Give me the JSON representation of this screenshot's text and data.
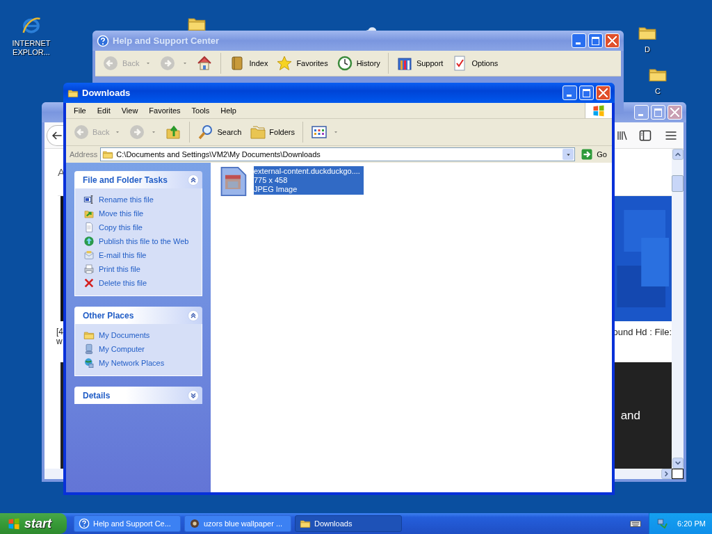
{
  "desktop_icons": [
    {
      "kind": "browser",
      "label": "INTERNET EXPLOR..."
    },
    {
      "kind": "folder-partial"
    },
    {
      "kind": "app-partial"
    },
    {
      "kind": "folder",
      "label": "D"
    },
    {
      "kind": "folder",
      "label": "C"
    }
  ],
  "browser_window": {
    "heading_fragment": "A",
    "caption_left": [
      "[4",
      "w"
    ],
    "caption_right": "ound Hd : File:",
    "banner_text": "and"
  },
  "help_window": {
    "title": "Help and Support Center",
    "toolbar": [
      {
        "kind": "back",
        "label": "Back",
        "disabled": true
      },
      {
        "kind": "forward",
        "disabled": true
      },
      {
        "kind": "home",
        "disabled": false
      },
      {
        "kind": "separator"
      },
      {
        "kind": "index",
        "label": "Index",
        "disabled": false
      },
      {
        "kind": "favorites",
        "label": "Favorites",
        "disabled": false
      },
      {
        "kind": "history",
        "label": "History",
        "disabled": false
      },
      {
        "kind": "separator"
      },
      {
        "kind": "support",
        "label": "Support",
        "disabled": false
      },
      {
        "kind": "options",
        "label": "Options",
        "disabled": false
      }
    ]
  },
  "downloads_window": {
    "title": "Downloads",
    "menu": [
      "File",
      "Edit",
      "View",
      "Favorites",
      "Tools",
      "Help"
    ],
    "toolbar": [
      {
        "kind": "back",
        "label": "Back",
        "disabled": true
      },
      {
        "kind": "forward",
        "disabled": true
      },
      {
        "kind": "up",
        "disabled": false
      },
      {
        "kind": "separator"
      },
      {
        "kind": "search",
        "label": "Search",
        "disabled": false
      },
      {
        "kind": "folders",
        "label": "Folders",
        "disabled": false
      },
      {
        "kind": "separator"
      },
      {
        "kind": "views",
        "disabled": false
      }
    ],
    "address": {
      "label": "Address",
      "value": "C:\\Documents and Settings\\VM2\\My Documents\\Downloads",
      "go": "Go"
    },
    "panels": [
      {
        "title": "File and Folder Tasks",
        "expanded": true,
        "items": [
          {
            "kind": "rename",
            "label": "Rename this file"
          },
          {
            "kind": "move",
            "label": "Move this file"
          },
          {
            "kind": "copy",
            "label": "Copy this file"
          },
          {
            "kind": "publish",
            "label": "Publish this file to the Web"
          },
          {
            "kind": "email",
            "label": "E-mail this file"
          },
          {
            "kind": "print",
            "label": "Print this file"
          },
          {
            "kind": "delete",
            "label": "Delete this file"
          }
        ]
      },
      {
        "title": "Other Places",
        "expanded": true,
        "items": [
          {
            "kind": "folder",
            "label": "My Documents"
          },
          {
            "kind": "computer",
            "label": "My Computer"
          },
          {
            "kind": "network",
            "label": "My Network Places"
          }
        ]
      },
      {
        "title": "Details",
        "expanded": false
      }
    ],
    "files": [
      {
        "name": "external-content.duckduckgo....",
        "dimensions": "775 x 458",
        "type": "JPEG Image",
        "selected": true
      }
    ]
  },
  "taskbar": {
    "start": "start",
    "tasks": [
      {
        "kind": "help",
        "label": "Help and Support Ce...",
        "selected": false
      },
      {
        "kind": "app",
        "label": "uzors blue wallpaper ...",
        "selected": false
      },
      {
        "kind": "folder",
        "label": "Downloads",
        "selected": true
      }
    ],
    "clock": "6:20 PM"
  }
}
